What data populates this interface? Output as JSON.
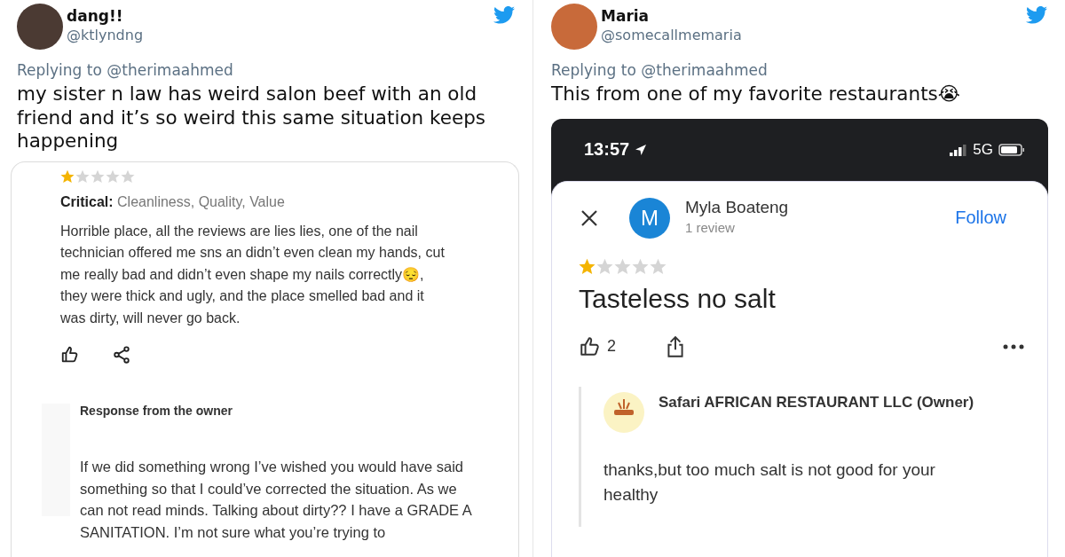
{
  "tweets": [
    {
      "name": "dang!!",
      "handle": "@ktlyndng",
      "replying_to": "Replying to @therimaahmed",
      "text": "my sister n law has weird salon beef with an old friend and it’s so weird this same situation keeps happening",
      "review": {
        "kind": "card",
        "stars": 1,
        "critical": "**Critical:** Cleanliness, Quality, Value",
        "text": "Horrible place, all the reviews are lies lies, one of the nail technician offered me sns an didn’t even clean my hands, cut me really bad and didn’t even shape my nails correctly😔, they were thick and ugly, and the place smelled bad and it was dirty, will never go back.",
        "owner": {
          "name": "Response from the owner",
          "text": "If we did something wrong I’ve wished you would have said something so that I could’ve corrected the situation. As we can not read minds. Talking about dirty?? I have a GRADE A SANITATION. I’m not sure what you’re trying to"
        }
      }
    },
    {
      "name": "Maria",
      "handle": "@somecallmemaria",
      "replying_to": "Replying to @therimaahmed",
      "text": "This from one of my favorite restaurants😭",
      "review": {
        "kind": "phone",
        "time": "13:57",
        "network": "5G",
        "initial": "M",
        "reviewer": "Myla Boateng",
        "meta": "1 review",
        "follow": "Follow",
        "stars": 1,
        "text": "Tasteless no salt",
        "likes": "2",
        "owner": {
          "name": "Safari AFRICAN RESTAURANT LLC (Owner)",
          "text": "thanks,but too much salt is not good for your healthy"
        }
      }
    }
  ]
}
